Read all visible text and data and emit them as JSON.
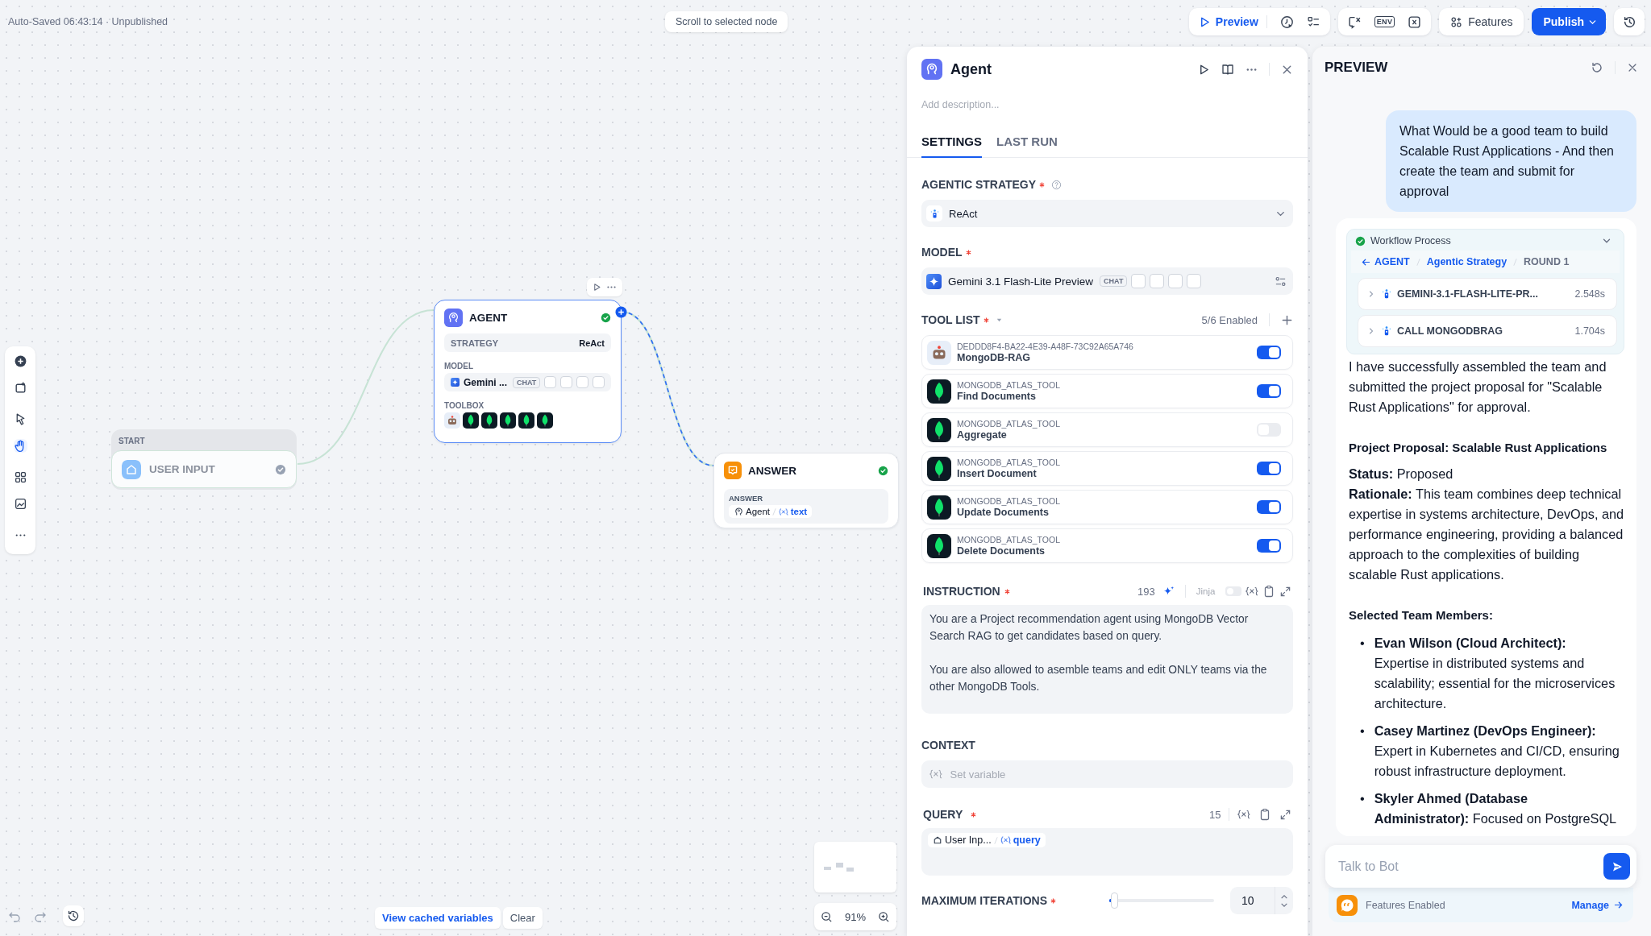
{
  "top_bar": {
    "save_status": "Auto-Saved 06:43:14 · Unpublished",
    "scroll_button": "Scroll to selected node",
    "preview_button": "Preview",
    "env_label": "ENV",
    "features_button": "Features",
    "publish_button": "Publish"
  },
  "canvas": {
    "nodes": [
      {
        "kind": "start",
        "group_label": "START",
        "title": "USER INPUT",
        "succeeded": false,
        "selected": false
      },
      {
        "kind": "agent",
        "title": "AGENT",
        "succeeded": true,
        "selected": true,
        "strategy_label": "STRATEGY",
        "strategy": "ReAct",
        "model_label": "MODEL",
        "model": "Gemini ...",
        "model_tag": "CHAT",
        "toolbox_label": "TOOLBOX",
        "toolbox": [
          {
            "kind": "robot"
          },
          {
            "kind": "mongodb"
          },
          {
            "kind": "mongodb"
          },
          {
            "kind": "mongodb"
          },
          {
            "kind": "mongodb"
          },
          {
            "kind": "mongodb"
          }
        ]
      },
      {
        "kind": "answer",
        "title": "ANSWER",
        "succeeded": true,
        "selected": false,
        "field_label": "ANSWER",
        "variable": {
          "node": "Agent",
          "name": "text"
        }
      }
    ],
    "cached_button": "View cached variables",
    "clear_button": "Clear",
    "zoom": "91%"
  },
  "agent_panel": {
    "title": "Agent",
    "description_placeholder": "Add description...",
    "tabs": [
      {
        "label": "SETTINGS",
        "selected": true
      },
      {
        "label": "LAST RUN",
        "selected": false
      }
    ],
    "strategy": {
      "label": "AGENTIC STRATEGY",
      "required": true,
      "value": "ReAct"
    },
    "model": {
      "label": "MODEL",
      "required": true,
      "value": "Gemini 3.1 Flash-Lite Preview",
      "tag": "CHAT"
    },
    "tool_list": {
      "label": "TOOL LIST",
      "required": true,
      "enabled_count": "5/6 Enabled",
      "tools": [
        {
          "kind": "robot",
          "provider": "DEDDD8F4-BA22-4E39-A48F-73C92A65A746",
          "name": "MongoDB-RAG",
          "on": true
        },
        {
          "kind": "mongodb",
          "provider": "MONGODB_ATLAS_TOOL",
          "name": "Find Documents",
          "on": true
        },
        {
          "kind": "mongodb",
          "provider": "MONGODB_ATLAS_TOOL",
          "name": "Aggregate",
          "on": false
        },
        {
          "kind": "mongodb",
          "provider": "MONGODB_ATLAS_TOOL",
          "name": "Insert Document",
          "on": true
        },
        {
          "kind": "mongodb",
          "provider": "MONGODB_ATLAS_TOOL",
          "name": "Update Documents",
          "on": true
        },
        {
          "kind": "mongodb",
          "provider": "MONGODB_ATLAS_TOOL",
          "name": "Delete Documents",
          "on": true
        }
      ]
    },
    "instruction": {
      "label": "INSTRUCTION",
      "required": true,
      "count": "193",
      "jinja_label": "Jinja",
      "jinja_on": false,
      "value": "You are a Project recommendation agent using MongoDB Vector Search RAG to get candidates based on query.\n\nYou are also allowed to asemble teams and edit ONLY teams via the other MongoDB Tools."
    },
    "context": {
      "label": "CONTEXT",
      "required": false,
      "placeholder": "Set variable"
    },
    "query": {
      "label": "QUERY",
      "required": true,
      "count": "15",
      "variable": {
        "node": "User Inp...",
        "name": "query"
      }
    },
    "max_iterations": {
      "label": "MAXIMUM ITERATIONS",
      "required": true,
      "level": 0.02,
      "value": "10"
    }
  },
  "preview_panel": {
    "title": "PREVIEW",
    "user_message": "What Would be a good team to build Scalable Rust Applications - And then create the team and submit for approval",
    "workflow": {
      "title": "Workflow Process",
      "breadcrumb": [
        {
          "label": "AGENT",
          "current": false
        },
        {
          "label": "Agentic Strategy",
          "current": false
        },
        {
          "label": "ROUND 1",
          "current": true
        }
      ],
      "steps": [
        {
          "name": "GEMINI-3.1-FLASH-LITE-PR...",
          "time": "2.548s"
        },
        {
          "name": "CALL MONGODBRAG",
          "time": "1.704s"
        }
      ]
    },
    "answer": [
      {
        "kind": "paragraph",
        "text": "I have successfully assembled the team and submitted the project proposal for \"Scalable Rust Applications\" for approval."
      },
      {
        "kind": "heading",
        "text": "Project Proposal: Scalable Rust Applications"
      },
      {
        "kind": "line",
        "text": "**Status:** Proposed"
      },
      {
        "kind": "line",
        "text": "**Rationale:** This team combines deep technical expertise in systems architecture, DevOps, and performance engineering, providing a balanced approach to the complexities of building scalable Rust applications."
      },
      {
        "kind": "heading",
        "text": "Selected Team Members:"
      },
      {
        "kind": "list",
        "items": [
          {
            "marker": "•",
            "text": "**Evan Wilson (Cloud Architect):** Expertise in distributed systems and scalability; essential for the microservices architecture."
          },
          {
            "marker": "•",
            "text": "**Casey Martinez (DevOps Engineer):** Expert in Kubernetes and CI/CD, ensuring robust infrastructure deployment."
          },
          {
            "marker": "•",
            "text": "**Skyler Ahmed (Database Administrator):** Focused on PostgreSQL"
          }
        ]
      }
    ],
    "input_placeholder": "Talk to Bot",
    "features_label": "Features Enabled",
    "manage_link": "Manage"
  }
}
